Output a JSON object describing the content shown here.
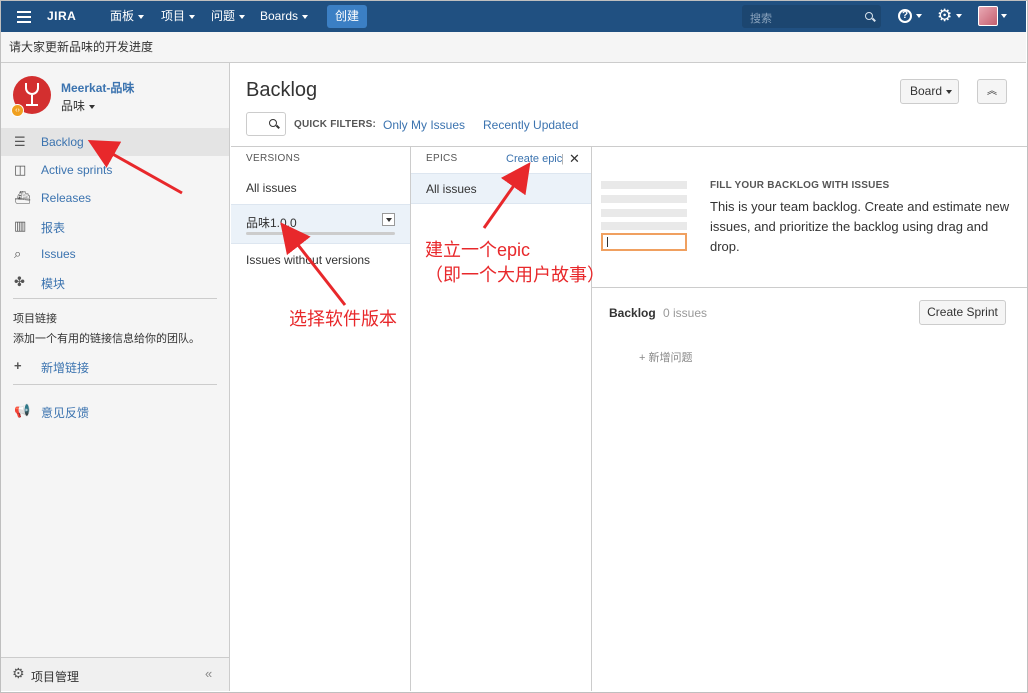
{
  "topnav": {
    "logo": "JIRA",
    "menus": [
      "面板",
      "项目",
      "问题",
      "Boards"
    ],
    "create_label": "创建",
    "search_placeholder": "搜索",
    "brand_color": "#205081"
  },
  "announcement": "请大家更新品味的开发进度",
  "sidebar": {
    "project_name": "Meerkat-品味",
    "project_sub": "品味",
    "items": [
      {
        "label": "Backlog",
        "icon": "backlog-icon"
      },
      {
        "label": "Active sprints",
        "icon": "sprints-icon"
      },
      {
        "label": "Releases",
        "icon": "releases-icon"
      },
      {
        "label": "报表",
        "icon": "reports-icon"
      },
      {
        "label": "Issues",
        "icon": "issues-icon"
      },
      {
        "label": "模块",
        "icon": "components-icon"
      }
    ],
    "links_heading": "项目链接",
    "links_desc": "添加一个有用的链接信息给你的团队。",
    "add_link": "新增链接",
    "feedback": "意见反馈",
    "settings": "项目管理"
  },
  "main": {
    "title": "Backlog",
    "board_button": "Board",
    "quick_filters_label": "QUICK FILTERS:",
    "quick_filters": [
      "Only My Issues",
      "Recently Updated"
    ],
    "versions": {
      "heading": "VERSIONS",
      "all": "All issues",
      "selected": "品味1.0.0",
      "without": "Issues without versions"
    },
    "epics": {
      "heading": "EPICS",
      "create": "Create epic",
      "separator": "|",
      "all": "All issues"
    },
    "fill": {
      "title": "FILL YOUR BACKLOG WITH ISSUES",
      "body": "This is your team backlog. Create and estimate new issues, and prioritize the backlog using drag and drop."
    },
    "backlog": {
      "label": "Backlog",
      "count": "0 issues",
      "create_sprint": "Create Sprint",
      "new_issue": "+ 新增问题"
    }
  },
  "annotations": {
    "epic_line1": "建立一个epic",
    "epic_line2": "（即一个大用户故事）",
    "version": "选择软件版本",
    "color": "#e8282b"
  }
}
